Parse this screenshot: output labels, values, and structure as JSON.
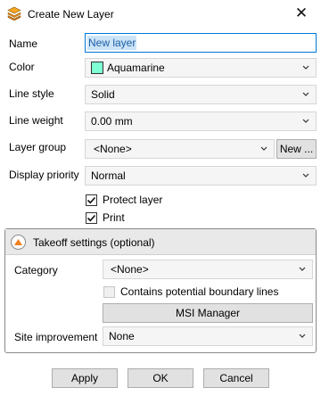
{
  "window": {
    "title": "Create New Layer",
    "close_glyph": "✕"
  },
  "fields": {
    "name": {
      "label": "Name",
      "value": "New layer"
    },
    "color": {
      "label": "Color",
      "value": "Aquamarine",
      "swatch": "#7fffd4"
    },
    "line_style": {
      "label": "Line style",
      "value": "Solid"
    },
    "line_weight": {
      "label": "Line weight",
      "value": "0.00 mm"
    },
    "layer_group": {
      "label": "Layer group",
      "value": "<None>",
      "new_button": "New ..."
    },
    "display_priority": {
      "label": "Display priority",
      "value": "Normal"
    }
  },
  "checks": {
    "protect_layer": {
      "label": "Protect layer",
      "checked": true
    },
    "print": {
      "label": "Print",
      "checked": true
    }
  },
  "takeoff": {
    "title": "Takeoff settings (optional)",
    "category": {
      "label": "Category",
      "value": "<None>"
    },
    "boundary": {
      "label": "Contains potential boundary lines",
      "checked": false,
      "enabled": false
    },
    "msi_button": "MSI Manager",
    "site_improvement": {
      "label": "Site improvement",
      "value": "None"
    }
  },
  "footer": {
    "apply": "Apply",
    "ok": "OK",
    "cancel": "Cancel"
  },
  "colors": {
    "accent": "#0078d7",
    "collapse_icon": "#f07f1d"
  }
}
